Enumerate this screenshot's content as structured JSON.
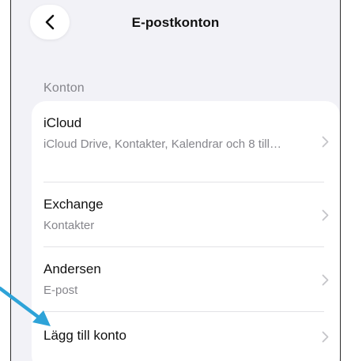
{
  "nav": {
    "title": "E-postkonton"
  },
  "section": {
    "header": "Konton"
  },
  "accounts": [
    {
      "title": "iCloud",
      "subtitle": "iCloud Drive, Kontakter, Kalendrar och 8 till…"
    },
    {
      "title": "Exchange",
      "subtitle": "Kontakter"
    },
    {
      "title": "Andersen",
      "subtitle": "E-post"
    }
  ],
  "add_account": {
    "label": "Lägg till konto"
  },
  "colors": {
    "background": "#f2f2f7",
    "card": "#ffffff",
    "secondary_text": "#85858b",
    "chevron": "#c4c4c8",
    "annotation_arrow": "#2ea3d8"
  },
  "icons": {
    "back": "chevron-left-icon",
    "disclosure": "chevron-right-icon",
    "annotation": "arrow-pointer-icon"
  }
}
